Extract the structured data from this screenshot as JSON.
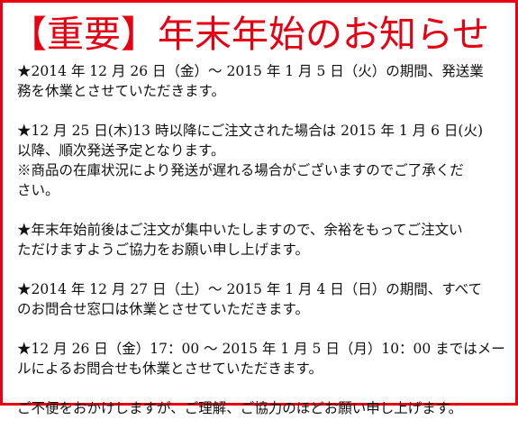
{
  "notice": {
    "title": "【重要】年末年始のお知らせ",
    "paragraphs": [
      {
        "lines": [
          "★2014 年 12 月 26 日（金）～ 2015 年 1 月 5 日（火）の期間、発送業",
          "務を休業とさせていただきます。"
        ]
      },
      {
        "lines": [
          "★12 月 25 日(木)13 時以降にご注文された場合は 2015 年 1 月 6 日(火)",
          "以降、順次発送予定となります。",
          "※商品の在庫状況により発送が遅れる場合がございますのでご了承くだ",
          "さい。"
        ]
      },
      {
        "lines": [
          "★年末年始前後はご注文が集中いたしますので、余裕をもってご注文い",
          "ただけますようご協力をお願い申し上げます。"
        ]
      },
      {
        "lines": [
          "★2014 年 12 月 27 日（土）～ 2015 年 1 月 4 日（日）の期間、すべて",
          "のお問合せ窓口は休業とさせていただきます。"
        ]
      },
      {
        "lines": [
          "★12 月 26 日（金）17：00 ～ 2015 年 1 月 5 日（月）10：00 まではメー",
          "ルによるお問合せも休業とさせていただきます。"
        ]
      },
      {
        "lines": [
          "ご不便をおかけしますが、ご理解、ご協力のほどお願い申し上げます。"
        ]
      }
    ]
  },
  "colors": {
    "accent": "#e60012",
    "text": "#111111",
    "background": "#ffffff"
  }
}
